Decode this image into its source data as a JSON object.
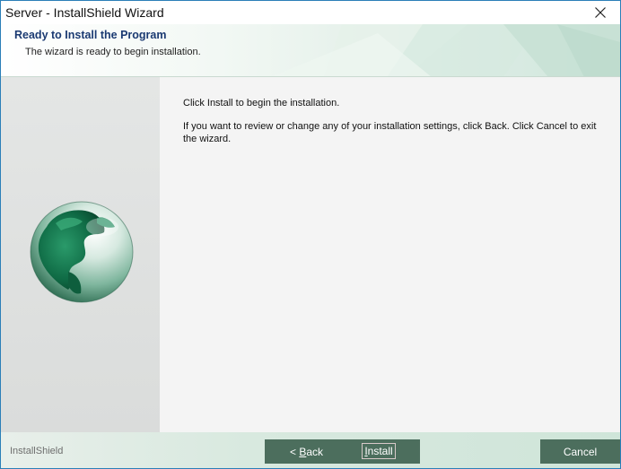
{
  "window": {
    "title": "Server - InstallShield Wizard"
  },
  "header": {
    "title": "Ready to Install the Program",
    "subtitle": "The wizard is ready to begin installation."
  },
  "content": {
    "line1": "Click Install to begin the installation.",
    "line2": "If you want to review or change any of your installation settings, click Back. Click Cancel to exit the wizard."
  },
  "footer": {
    "brand": "InstallShield",
    "back_prefix": "< ",
    "back_access_key": "B",
    "back_rest": "ack",
    "install_access_key": "I",
    "install_rest": "nstall",
    "cancel_label": "Cancel"
  },
  "icons": {
    "close": "close-icon",
    "globe": "globe-icon"
  },
  "colors": {
    "header_title": "#1b3a72",
    "button_bg": "#4c6e5d",
    "window_border": "#2b7fb8"
  }
}
